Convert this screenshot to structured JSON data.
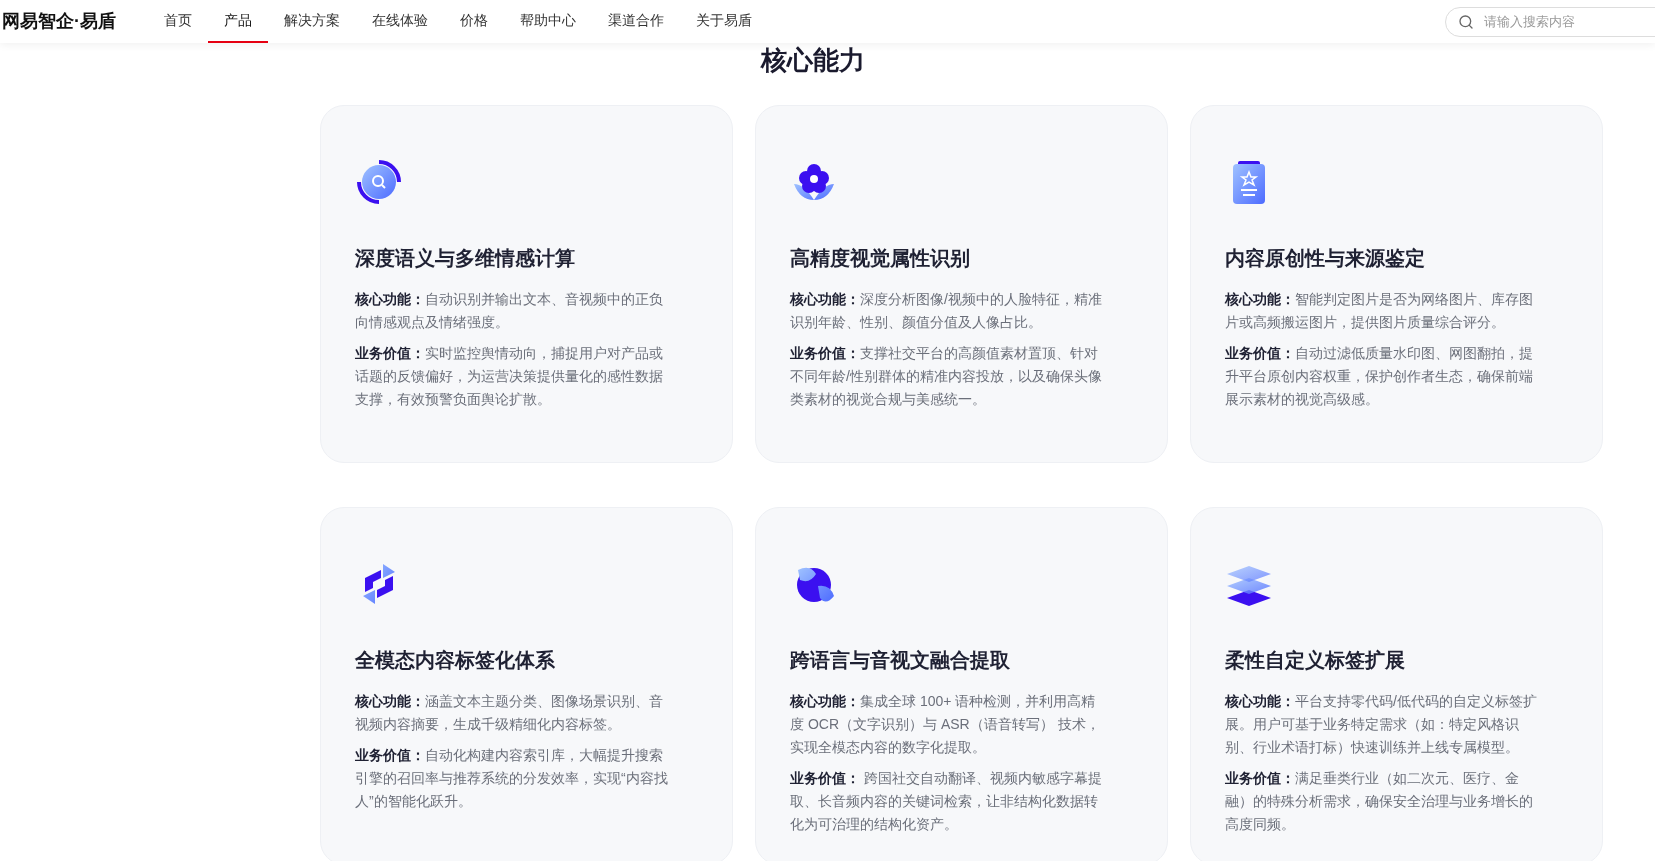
{
  "nav": {
    "logo": "网易智企·易盾",
    "items": [
      {
        "label": "首页",
        "selected": false
      },
      {
        "label": "产品",
        "selected": true
      },
      {
        "label": "解决方案",
        "selected": false
      },
      {
        "label": "在线体验",
        "selected": false
      },
      {
        "label": "价格",
        "selected": false
      },
      {
        "label": "帮助中心",
        "selected": false
      },
      {
        "label": "渠道合作",
        "selected": false
      },
      {
        "label": "关于易盾",
        "selected": false
      }
    ],
    "search": {
      "placeholder": "请输入搜索内容"
    }
  },
  "section": {
    "title": "核心能力",
    "cards": [
      {
        "title": "深度语义与多维情感计算",
        "features": [
          {
            "label": "核心功能：",
            "text": "自动识别并输出文本、音视频中的正负向情感观点及情绪强度。"
          },
          {
            "label": "业务价值：",
            "text": "实时监控舆情动向，捕捉用户对产品或话题的反馈偏好，为运营决策提供量化的感性数据支撑，有效预警负面舆论扩散。"
          }
        ]
      },
      {
        "title": "高精度视觉属性识别",
        "features": [
          {
            "label": "核心功能：",
            "text": "深度分析图像/视频中的人脸特征，精准识别年龄、性别、颜值分值及人像占比。"
          },
          {
            "label": "业务价值：",
            "text": "支撑社交平台的高颜值素材置顶、针对不同年龄/性别群体的精准内容投放，以及确保头像类素材的视觉合规与美感统一。"
          }
        ]
      },
      {
        "title": "内容原创性与来源鉴定",
        "features": [
          {
            "label": "核心功能：",
            "text": "智能判定图片是否为网络图片、库存图片或高频搬运图片，提供图片质量综合评分。"
          },
          {
            "label": "业务价值：",
            "text": "自动过滤低质量水印图、网图翻拍，提升平台原创内容权重，保护创作者生态，确保前端展示素材的视觉高级感。"
          }
        ]
      },
      {
        "title": "全模态内容标签化体系",
        "features": [
          {
            "label": "核心功能：",
            "text": "涵盖文本主题分类、图像场景识别、音视频内容摘要，生成千级精细化内容标签。"
          },
          {
            "label": "业务价值：",
            "text": "自动化构建内容索引库，大幅提升搜索引擎的召回率与推荐系统的分发效率，实现“内容找人”的智能化跃升。"
          }
        ]
      },
      {
        "title": "跨语言与音视文融合提取",
        "features": [
          {
            "label": "核心功能：",
            "text": "集成全球 100+ 语种检测，并利用高精度 OCR（文字识别）与 ASR（语音转写） 技术，实现全模态内容的数字化提取。"
          },
          {
            "label": "业务价值：",
            "text": " 跨国社交自动翻译、视频内敏感字幕提取、长音频内容的关键词检索，让非结构化数据转化为可治理的结构化资产。"
          }
        ]
      },
      {
        "title": "柔性自定义标签扩展",
        "features": [
          {
            "label": "核心功能：",
            "text": "平台支持零代码/低代码的自定义标签扩展。用户可基于业务特定需求（如：特定风格识别、行业术语打标）快速训练并上线专属模型。"
          },
          {
            "label": "业务价值：",
            "text": "满足垂类行业（如二次元、医疗、金融）的特殊分析需求，确保安全治理与业务增长的高度同频。"
          }
        ]
      }
    ]
  }
}
